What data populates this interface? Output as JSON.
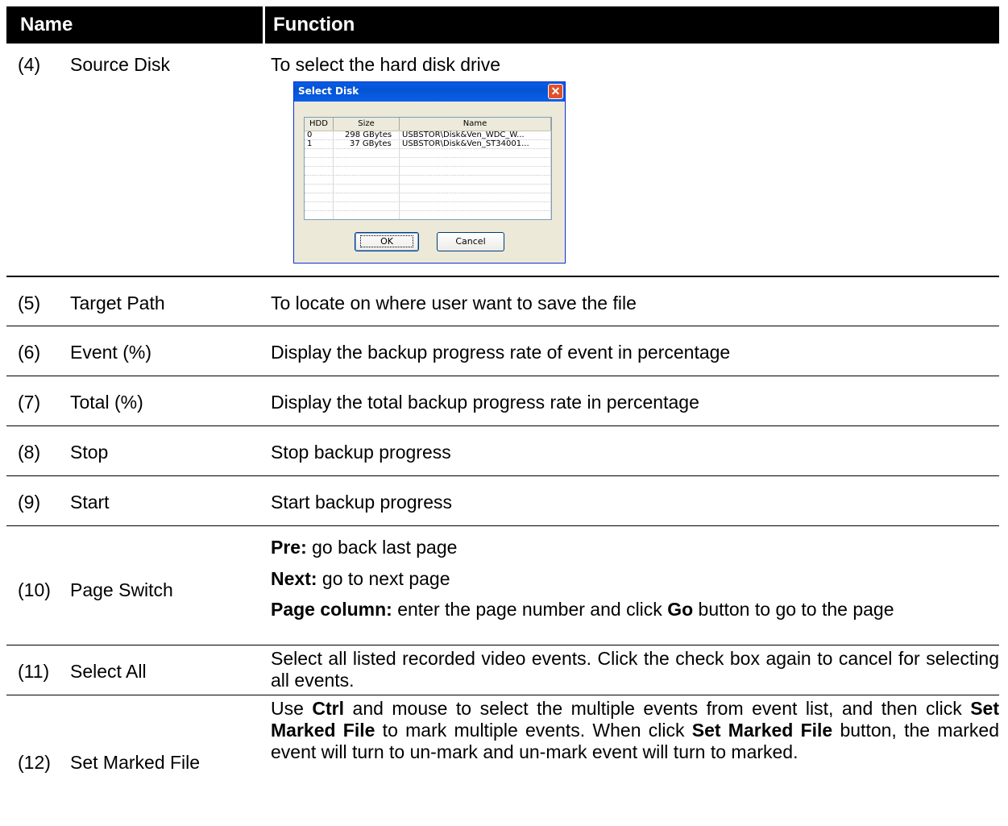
{
  "header": {
    "name": "Name",
    "function": "Function"
  },
  "rows": [
    {
      "num": "(4)",
      "name": "Source Disk",
      "desc": "To select the hard disk drive"
    },
    {
      "num": "(5)",
      "name": "Target Path",
      "desc": "To locate on where user want to save the file"
    },
    {
      "num": "(6)",
      "name": "Event (%)",
      "desc": "Display the backup progress rate of event in percentage"
    },
    {
      "num": "(7)",
      "name": "Total (%)",
      "desc": "Display the total backup progress rate in percentage"
    },
    {
      "num": "(8)",
      "name": "Stop",
      "desc": "Stop backup progress"
    },
    {
      "num": "(9)",
      "name": "Start",
      "desc": "Start backup progress"
    },
    {
      "num": "(10)",
      "name": "Page Switch",
      "pre_label": "Pre:",
      "pre_text": " go back last page",
      "next_label": "Next:",
      "next_text": " go to next page",
      "page_label": "Page column:",
      "page_text_1": " enter the page number and click ",
      "go_label": "Go",
      "page_text_2": " button to go to the page"
    },
    {
      "num": "(11)",
      "name": "Select All",
      "desc": "Select all listed recorded video events. Click the check box again to cancel for selecting all events."
    },
    {
      "num": "(12)",
      "name": "Set Marked File",
      "t1": "Use ",
      "ctrl": "Ctrl",
      "t2": " and mouse to select the multiple events from event list, and then click ",
      "smf1": "Set Marked File",
      "t3": " to mark multiple events. When click ",
      "smf2": "Set Marked File",
      "t4": " button, the marked event will turn to un-mark and un-mark event will turn to marked."
    }
  ],
  "dialog": {
    "title": "Select Disk",
    "columns": [
      "HDD",
      "Size",
      "Name"
    ],
    "disks": [
      {
        "hdd": "0",
        "size": "298 GBytes",
        "name": "USBSTOR\\Disk&Ven_WDC_W..."
      },
      {
        "hdd": "1",
        "size": "37 GBytes",
        "name": "USBSTOR\\Disk&Ven_ST34001..."
      }
    ],
    "ok": "OK",
    "cancel": "Cancel"
  }
}
